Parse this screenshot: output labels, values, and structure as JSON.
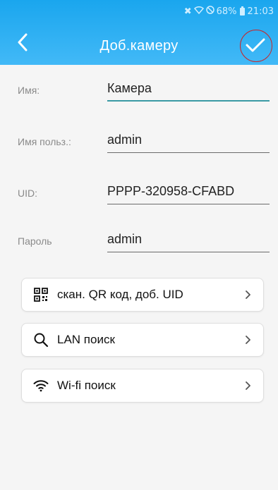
{
  "status_bar": {
    "mute_icon": "mute-icon",
    "wifi_icon": "wifi-icon",
    "dnd_icon": "do-not-disturb-icon",
    "battery": "68%",
    "time": "21:03"
  },
  "header": {
    "title": "Доб.камеру",
    "back_icon": "chevron-left-icon",
    "confirm_icon": "checkmark-icon"
  },
  "form": {
    "name": {
      "label": "Имя:",
      "value": "Камера"
    },
    "username": {
      "label": "Имя польз.:",
      "value": "admin"
    },
    "uid": {
      "label": "UID:",
      "value": "PPPP-320958-CFABD"
    },
    "password": {
      "label": "Пароль",
      "value": "admin"
    }
  },
  "actions": [
    {
      "label": "скан. QR код, доб. UID",
      "icon": "qr-code-icon"
    },
    {
      "label": "LAN поиск",
      "icon": "search-icon"
    },
    {
      "label": "Wi-fi поиск",
      "icon": "wifi-icon"
    }
  ],
  "colors": {
    "header_top": "#1aa6ee",
    "header_bottom": "#42b9f7",
    "focus_underline": "#3a9aa4",
    "annotation": "#c8262a"
  }
}
